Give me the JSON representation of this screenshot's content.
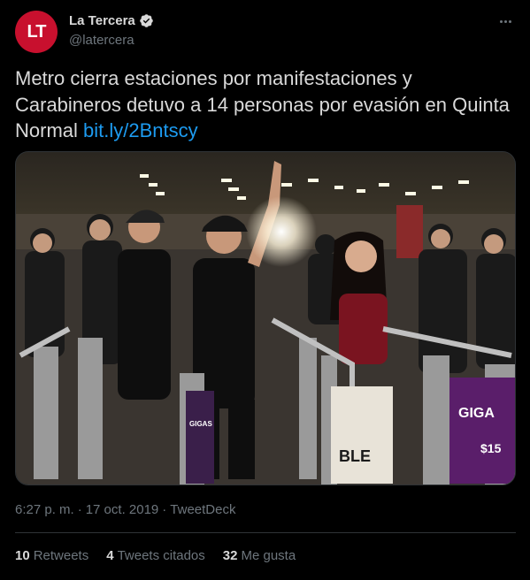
{
  "author": {
    "initials": "LT",
    "name": "La Tercera",
    "handle": "@latercera",
    "brand_color": "#c8102e"
  },
  "tweet": {
    "text": "Metro cierra estaciones por manifestaciones y Carabineros detuvo a 14 personas por evasión en Quinta Normal ",
    "link": "bit.ly/2Bntscy",
    "link_color": "#1d9bf0"
  },
  "meta": {
    "time": "6:27 p. m.",
    "separator1": "·",
    "date": "17 oct. 2019",
    "separator2": "·",
    "app": "TweetDeck"
  },
  "stats": [
    {
      "count": "10",
      "label": "Retweets"
    },
    {
      "count": "4",
      "label": "Tweets citados"
    },
    {
      "count": "32",
      "label": "Me gusta"
    }
  ],
  "media": {
    "ad_text_1": "GIGAS",
    "ad_text_2": "GIGA",
    "ad_text_3": "BLE",
    "ad_price": "$15"
  },
  "icons": {
    "verified": "verified-badge-icon",
    "more": "more-options-icon"
  }
}
